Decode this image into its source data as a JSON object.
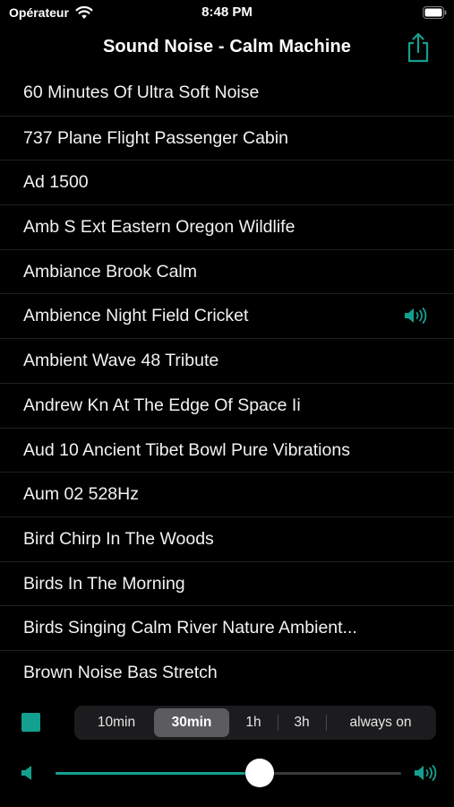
{
  "status_bar": {
    "carrier": "Opérateur",
    "time": "8:48 PM"
  },
  "nav": {
    "title": "Sound Noise - Calm Machine",
    "share_icon": "share-icon"
  },
  "sounds": [
    {
      "label": "60 Minutes Of Ultra Soft Noise",
      "playing": false
    },
    {
      "label": "737 Plane Flight Passenger Cabin",
      "playing": false
    },
    {
      "label": "Ad 1500",
      "playing": false
    },
    {
      "label": "Amb S Ext Eastern Oregon Wildlife",
      "playing": false
    },
    {
      "label": "Ambiance Brook Calm",
      "playing": false
    },
    {
      "label": "Ambience Night Field Cricket",
      "playing": true
    },
    {
      "label": "Ambient Wave 48 Tribute",
      "playing": false
    },
    {
      "label": "Andrew Kn At The Edge Of Space Ii",
      "playing": false
    },
    {
      "label": "Aud 10 Ancient Tibet Bowl Pure Vibrations",
      "playing": false
    },
    {
      "label": "Aum 02 528Hz",
      "playing": false
    },
    {
      "label": "Bird Chirp In The Woods",
      "playing": false
    },
    {
      "label": "Birds In The Morning",
      "playing": false
    },
    {
      "label": "Birds Singing Calm River Nature Ambient...",
      "playing": false
    },
    {
      "label": "Brown Noise Bas Stretch",
      "playing": false
    }
  ],
  "timer": {
    "options": [
      "10min",
      "30min",
      "1h",
      "3h",
      "always on"
    ],
    "selected": "30min"
  },
  "volume": {
    "level": 0.59
  },
  "colors": {
    "accent": "#13a08f",
    "background": "#000000",
    "segment_selected": "#5c5c60"
  }
}
